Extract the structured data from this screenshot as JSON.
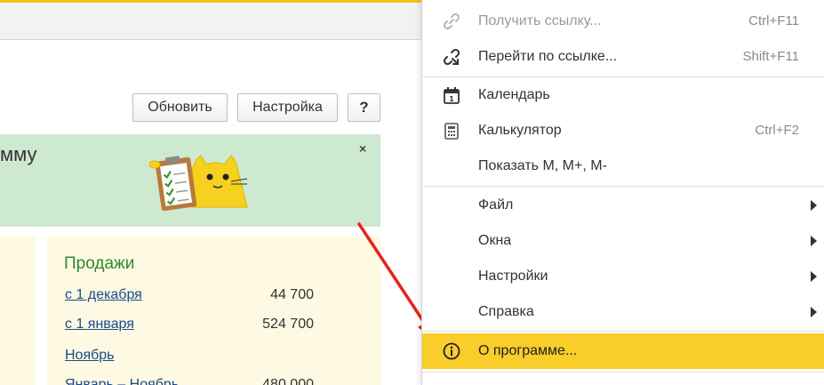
{
  "toolbar": {
    "refresh_label": "Обновить",
    "settings_label": "Настройка",
    "help_label": "?"
  },
  "banner": {
    "text": "мму",
    "close_label": "×"
  },
  "sales": {
    "title": "Продажи",
    "rows": [
      {
        "label": "с 1 декабря",
        "value": "44 700"
      },
      {
        "label": "с 1 января",
        "value": "524 700"
      },
      {
        "label": "Ноябрь",
        "value": ""
      },
      {
        "label": "Январь – Ноябрь",
        "value": "480 000"
      }
    ]
  },
  "menu": {
    "items": [
      {
        "label": "Получить ссылку...",
        "shortcut": "Ctrl+F11",
        "icon": "link-icon"
      },
      {
        "label": "Перейти по ссылке...",
        "shortcut": "Shift+F11",
        "icon": "follow-link-icon"
      },
      {
        "label": "Календарь",
        "shortcut": "",
        "icon": "calendar-icon"
      },
      {
        "label": "Калькулятор",
        "shortcut": "Ctrl+F2",
        "icon": "calculator-icon"
      },
      {
        "label": "Показать M, M+, M-",
        "shortcut": ""
      },
      {
        "label": "Файл"
      },
      {
        "label": "Окна"
      },
      {
        "label": "Настройки"
      },
      {
        "label": "Справка"
      },
      {
        "label": "О программе...",
        "icon": "info-icon"
      }
    ]
  },
  "colors": {
    "accent": "#f9cd2a",
    "banner_bg": "#cde9cf",
    "panel_bg": "#fdf9e2",
    "sales_title": "#2f8a2f",
    "link": "#1a4b8c",
    "annotation_arrow": "#e8221b"
  }
}
